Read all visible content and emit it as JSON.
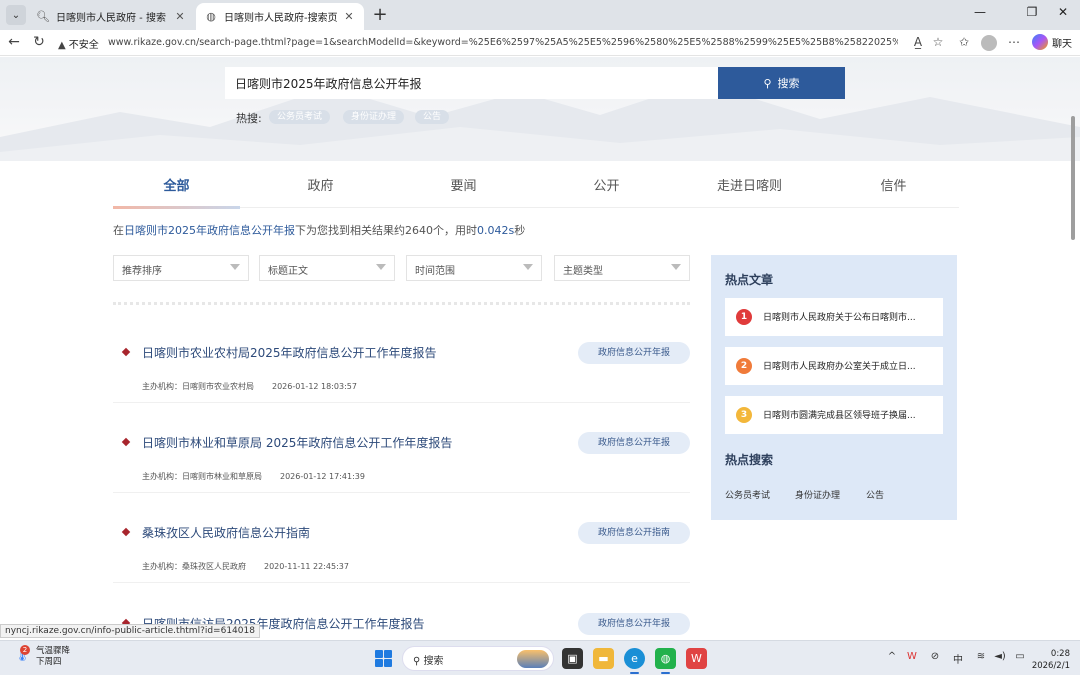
{
  "browser": {
    "tabs": [
      {
        "title": "日喀则市人民政府 - 搜索",
        "icon": "search-icon",
        "active": false
      },
      {
        "title": "日喀则市人民政府-搜索页",
        "icon": "globe-icon",
        "active": true
      }
    ],
    "security_label": "不安全",
    "url": "www.rikaze.gov.cn/search-page.thtml?page=1&searchModelId=&keyword=%25E6%2597%25A5%25E5%2596%2580%25E5%2588%2599%25E5%25B8%25822025%25E5%25B9%258...",
    "copilot_label": "聊天"
  },
  "search": {
    "query": "日喀则市2025年政府信息公开年报",
    "button_label": "搜索",
    "hot_label": "热搜:",
    "hot_tags": [
      "公务员考试",
      "身份证办理",
      "公告"
    ]
  },
  "category_tabs": [
    "全部",
    "政府",
    "要闻",
    "公开",
    "走进日喀则",
    "信件"
  ],
  "summary": {
    "prefix": "在",
    "keyword": "日喀则市2025年政府信息公开年报",
    "middle": "下为您找到相关结果约2640个，用时",
    "time": "0.042s",
    "suffix": "秒"
  },
  "filters": [
    "推荐排序",
    "标题正文",
    "时间范围",
    "主题类型"
  ],
  "results": [
    {
      "title": "日喀则市农业农村局2025年政府信息公开工作年度报告",
      "org": "主办机构：日喀则市农业农村局",
      "date": "2026-01-12 18:03:57",
      "tag": "政府信息公开年报"
    },
    {
      "title": "日喀则市林业和草原局 2025年政府信息公开工作年度报告",
      "org": "主办机构：日喀则市林业和草原局",
      "date": "2026-01-12 17:41:39",
      "tag": "政府信息公开年报"
    },
    {
      "title": "桑珠孜区人民政府信息公开指南",
      "org": "主办机构：桑珠孜区人民政府",
      "date": "2020-11-11 22:45:37",
      "tag": "政府信息公开指南"
    },
    {
      "title": "日喀则市信访局2025年度政府信息公开工作年度报告",
      "org": "",
      "date": "",
      "tag": "政府信息公开年报"
    }
  ],
  "side": {
    "hot_articles_title": "热点文章",
    "hot_articles": [
      {
        "rank": "1",
        "text": "日喀则市人民政府关于公布日喀则市...",
        "color": "#e03b3b"
      },
      {
        "rank": "2",
        "text": "日喀则市人民政府办公室关于成立日...",
        "color": "#f07b3a"
      },
      {
        "rank": "3",
        "text": "日喀则市圆满完成县区领导班子换届...",
        "color": "#f3b73a"
      }
    ],
    "hot_search_title": "热点搜索",
    "hot_searches": [
      "公务员考试",
      "身份证办理",
      "公告"
    ]
  },
  "status_url": "nyncj.rikaze.gov.cn/info-public-article.thtml?id=614018",
  "taskbar": {
    "weather_badge": "2",
    "weather_title": "气温骤降",
    "weather_sub": "下周四",
    "search_placeholder": "搜索",
    "ime": "中",
    "time": "0:28",
    "date": "2026/2/1"
  },
  "colors": {
    "accent": "#2d5a9b",
    "panel": "#dde8f7",
    "diamond": "#a8252d"
  }
}
